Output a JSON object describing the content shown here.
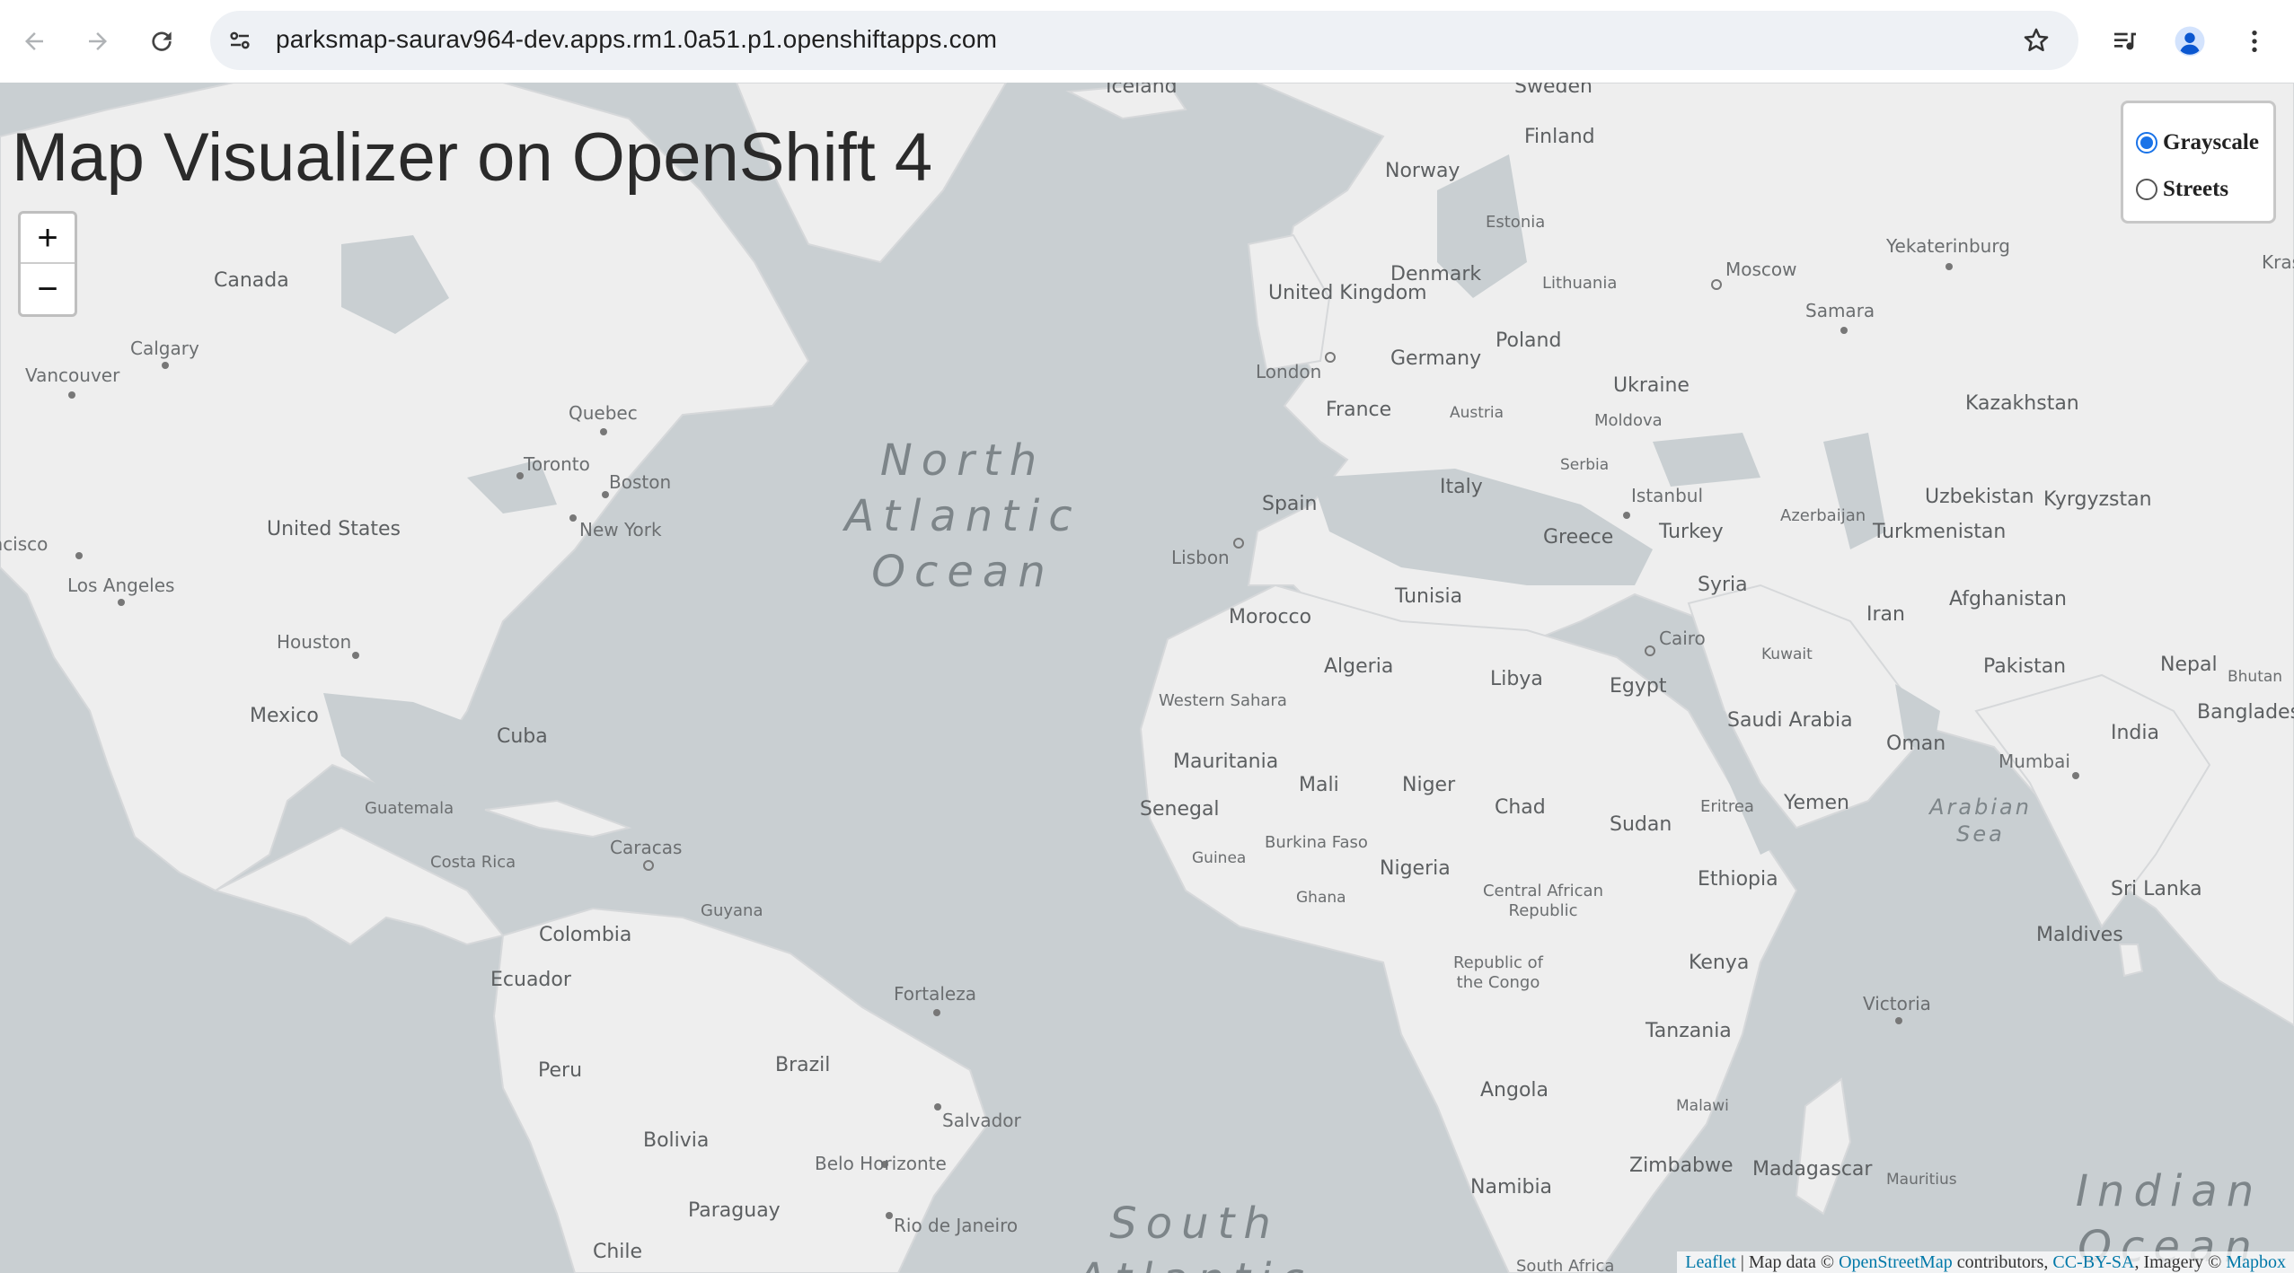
{
  "browser": {
    "url": "parksmap-saurav964-dev.apps.rm1.0a51.p1.openshiftapps.com",
    "back_icon": "arrow-left-icon",
    "forward_icon": "arrow-right-icon",
    "reload_icon": "reload-icon",
    "site_info_icon": "tune-icon",
    "bookmark_icon": "star-icon",
    "media_icon": "media-control-icon",
    "profile_icon": "profile-icon",
    "menu_icon": "more-vert-icon"
  },
  "page": {
    "title": "Map Visualizer on OpenShift 4"
  },
  "zoom": {
    "in_label": "+",
    "out_label": "−"
  },
  "layers": {
    "options": [
      {
        "label": "Grayscale",
        "selected": true
      },
      {
        "label": "Streets",
        "selected": false
      }
    ]
  },
  "attribution": {
    "leaflet": "Leaflet",
    "sep1": " | Map data © ",
    "osm": "OpenStreetMap",
    "contributors": " contributors, ",
    "ccbysa": "CC-BY-SA",
    "imagery": ", Imagery © ",
    "mapbox": "Mapbox"
  },
  "map_labels": {
    "countries": [
      "Iceland",
      "Sweden",
      "Finland",
      "Norway",
      "Estonia",
      "Canada",
      "Denmark",
      "United Kingdom",
      "Moscow",
      "Yekaterinburg",
      "Krasnoy",
      "Samara",
      "Lithuania",
      "Poland",
      "Germany",
      "London",
      "Calgary",
      "Ukraine",
      "Vancouver",
      "France",
      "Austria",
      "Moldova",
      "Kazakhstan",
      "Quebec",
      "Toronto",
      "Boston",
      "Serbia",
      "Italy",
      "Spain",
      "Istanbul",
      "Uzbekistan",
      "Kyrgyzstan",
      "Azerbaijan",
      "Turkey",
      "United States",
      "Turkmenistan",
      "New York",
      "Greece",
      "Lisbon",
      "San Francisco",
      "Tunisia",
      "Syria",
      "Afghanistan",
      "Los Angeles",
      "Morocco",
      "Iran",
      "Cairo",
      "Houston",
      "Algeria",
      "Libya",
      "Egypt",
      "Kuwait",
      "Pakistan",
      "Nepal",
      "Bhutan",
      "Western Sahara",
      "Mexico",
      "Saudi Arabia",
      "India",
      "Bangladesh",
      "Oman",
      "Cuba",
      "Mauritania",
      "Mumbai",
      "Mali",
      "Niger",
      "Chad",
      "Senegal",
      "Eritrea",
      "Yemen",
      "Sudan",
      "Guatemala",
      "Burkina Faso",
      "Guinea",
      "Caracas",
      "Nigeria",
      "Costa Rica",
      "Ethiopia",
      "Ghana",
      "Central African Republic",
      "Guyana",
      "Colombia",
      "Sri Lanka",
      "Maldives",
      "Republic of the Congo",
      "Ecuador",
      "Kenya",
      "Fortaleza",
      "Victoria",
      "Tanzania",
      "Brazil",
      "Peru",
      "Angola",
      "Malawi",
      "Salvador",
      "Bolivia",
      "Belo Horizonte",
      "Zimbabwe",
      "Madagascar",
      "Mauritius",
      "Paraguay",
      "Namibia",
      "Rio de Janeiro",
      "Chile",
      "South Africa"
    ],
    "oceans": [
      "North Atlantic Ocean",
      "Arabian Sea",
      "Indian Ocean",
      "South Atlantic"
    ]
  }
}
